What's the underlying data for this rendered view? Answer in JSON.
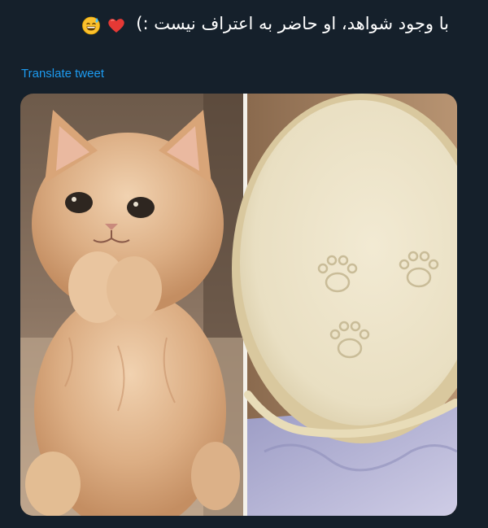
{
  "tweet": {
    "text": "با وجود شواهد، او حاضر به اعتراف نیست :)",
    "emojis": [
      "grinning-sweat-emoji",
      "red-heart-emoji"
    ],
    "translate_label": "Translate tweet"
  },
  "media": {
    "images": [
      {
        "subject": "kitten-photo"
      },
      {
        "subject": "pie-crust-with-paw-prints-photo"
      }
    ]
  },
  "colors": {
    "background": "#15202b",
    "text": "#ffffff",
    "link": "#1d9bf0"
  }
}
